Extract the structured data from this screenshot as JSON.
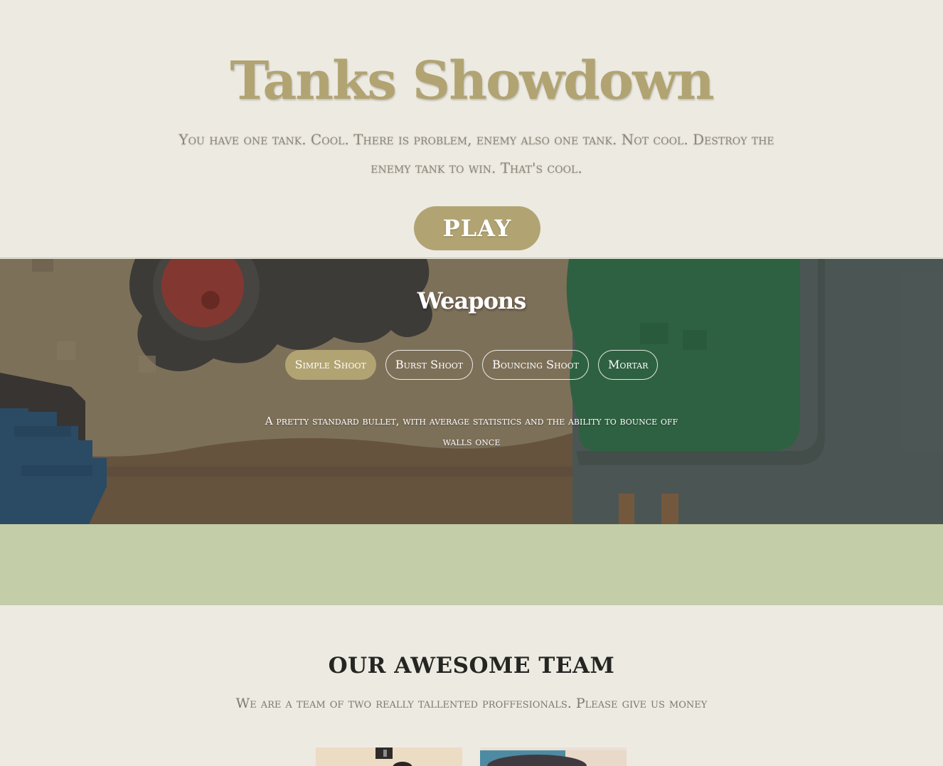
{
  "hero": {
    "title": "Tanks Showdown",
    "subtitle": "You have one tank. Cool. There is problem, enemy also one tank. Not cool. Destroy the enemy tank to win. That's cool.",
    "play_label": "PLAY"
  },
  "weapons": {
    "title": "Weapons",
    "tabs": [
      {
        "label": "Simple Shoot",
        "active": true
      },
      {
        "label": "Burst Shoot",
        "active": false
      },
      {
        "label": "Bouncing Shoot",
        "active": false
      },
      {
        "label": "Mortar",
        "active": false
      }
    ],
    "description": "A pretty standard bullet, with average statistics and the ability to bounce off walls once"
  },
  "team": {
    "title": "OUR AWESOME TEAM",
    "subtitle": "We are a team of two really tallented proffesionals. Please give us money"
  },
  "colors": {
    "accent": "#b1a472",
    "background": "#edeae2",
    "band": "#c3cda8",
    "heading_dark": "#252522"
  }
}
